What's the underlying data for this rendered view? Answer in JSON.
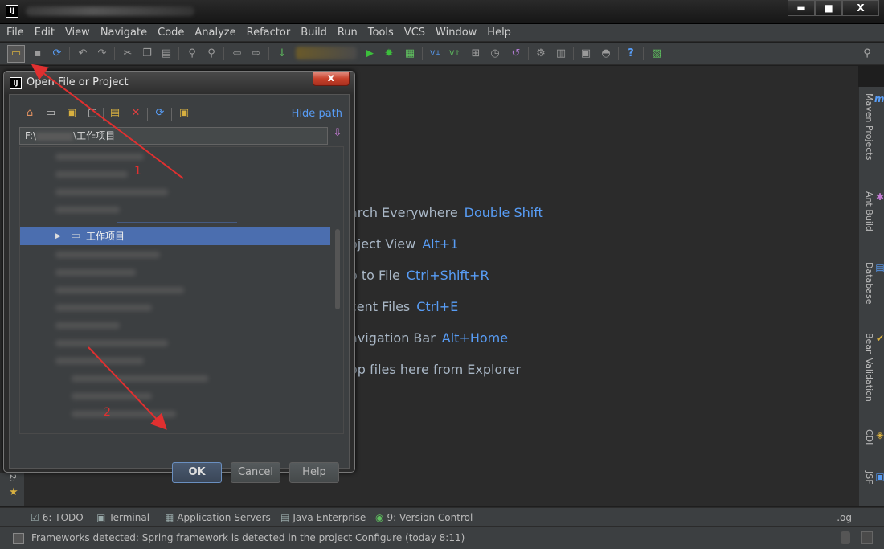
{
  "window": {
    "logo_text": "IJ",
    "controls": {
      "minimize": "▬",
      "maximize": "■",
      "close": "X"
    }
  },
  "menu": {
    "items": [
      "File",
      "Edit",
      "View",
      "Navigate",
      "Code",
      "Analyze",
      "Refactor",
      "Build",
      "Run",
      "Tools",
      "VCS",
      "Window",
      "Help"
    ]
  },
  "toolbar": {
    "icons": [
      "open-icon",
      "save-icon",
      "sync-icon",
      "undo-icon",
      "redo-icon",
      "cut-icon",
      "copy-icon",
      "paste-icon",
      "find-icon",
      "replace-icon",
      "back-icon",
      "forward-icon",
      "build-icon",
      "run-icon",
      "debug-icon",
      "coverage-icon",
      "vcs-update-icon",
      "vcs-commit-icon",
      "vcs-compare-icon",
      "vcs-history-icon",
      "vcs-revert-icon",
      "settings-icon",
      "project-structure-icon",
      "sdk-icon",
      "android-icon",
      "help-icon",
      "plugin-icon",
      "search-icon"
    ]
  },
  "editor": {
    "hints": [
      {
        "text": "arch Everywhere",
        "key": "Double Shift"
      },
      {
        "text": "oject View",
        "key": "Alt+1"
      },
      {
        "text": "o to File",
        "key": "Ctrl+Shift+R"
      },
      {
        "text": "cent Files",
        "key": "Ctrl+E"
      },
      {
        "text": "avigation Bar",
        "key": "Alt+Home"
      },
      {
        "text": "op files here from Explorer",
        "key": ""
      }
    ]
  },
  "right_strip": {
    "items": [
      {
        "label": "Maven Projects",
        "icon": "m"
      },
      {
        "label": "Ant Build",
        "icon": "✱"
      },
      {
        "label": "Database",
        "icon": "▤"
      },
      {
        "label": "Bean Validation",
        "icon": "✔"
      },
      {
        "label": "CDI",
        "icon": "◈"
      },
      {
        "label": "JSF",
        "icon": "▣"
      }
    ]
  },
  "left_strip": {
    "label": "2:",
    "icon": "★"
  },
  "bottom_bar": {
    "items": [
      {
        "prefix": "6",
        "label": ": TODO",
        "icon": "☑"
      },
      {
        "prefix": "",
        "label": "Terminal",
        "icon": "▣"
      },
      {
        "prefix": "",
        "label": "Application Servers",
        "icon": "▦"
      },
      {
        "prefix": "",
        "label": "Java Enterprise",
        "icon": "▤"
      },
      {
        "prefix": "9",
        "label": ": Version Control",
        "icon": "◉"
      }
    ],
    "log_label": ".og"
  },
  "status_bar": {
    "message": "Frameworks detected: Spring framework is detected in the project Configure (today 8:11)"
  },
  "dialog": {
    "title": "Open File or Project",
    "close_label": "x",
    "hide_path_label": "Hide path",
    "path_prefix": "F:\\",
    "path_suffix": "\\工作项目",
    "selected_item": "工作项目",
    "buttons": {
      "ok": "OK",
      "cancel": "Cancel",
      "help": "Help"
    }
  },
  "annotations": {
    "labels": [
      "1",
      "2"
    ],
    "color": "#e03030"
  },
  "colors": {
    "link": "#589df6",
    "selection": "#4b6eaf",
    "background": "#2b2b2b",
    "panel": "#3c3f41"
  }
}
